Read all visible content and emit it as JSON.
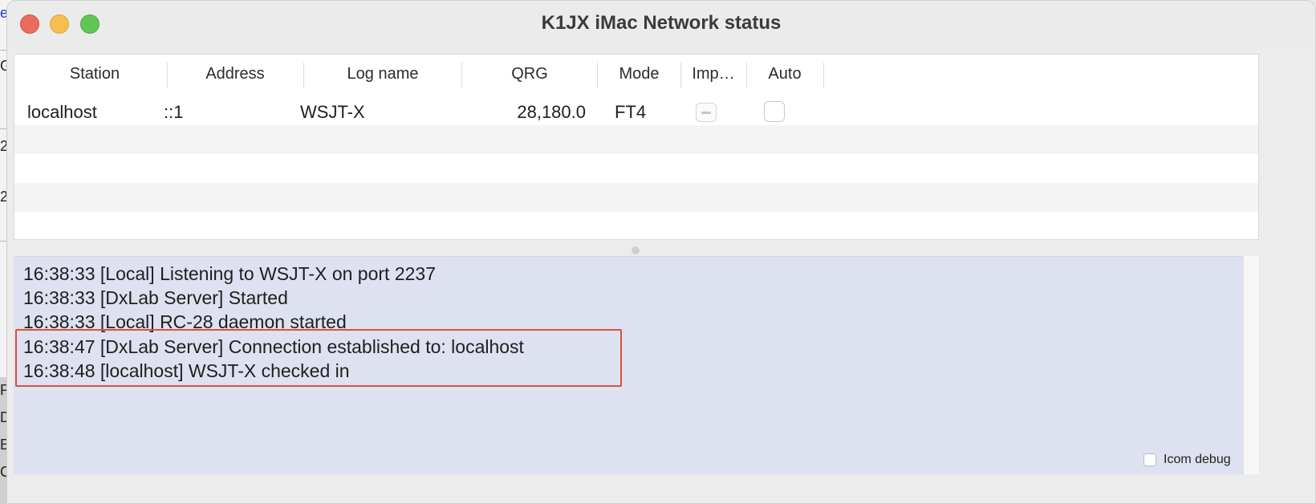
{
  "window": {
    "title": "K1JX iMac Network status"
  },
  "background_fragments": [
    "e",
    "G:",
    "2",
    "2",
    "P",
    "D",
    "E",
    "C"
  ],
  "table": {
    "columns": [
      "Station",
      "Address",
      "Log name",
      "QRG",
      "Mode",
      "Imp…",
      "Auto"
    ],
    "rows": [
      {
        "station": "localhost",
        "address": "::1",
        "log_name": "WSJT-X",
        "qrg": "28,180.0",
        "mode": "FT4",
        "imp": "mixed",
        "auto": false
      }
    ]
  },
  "log": {
    "lines": [
      "16:38:33 [Local] Listening to WSJT-X on port 2237",
      "16:38:33 [DxLab Server] Started",
      "16:38:33 [Local] RC-28 daemon started",
      "16:38:47 [DxLab Server] Connection established to: localhost",
      "16:38:48 [localhost] WSJT-X checked in"
    ],
    "highlighted_lines": [
      3,
      4
    ],
    "highlight_color": "#d9513e",
    "background_color": "#dde1f0"
  },
  "icom_debug": {
    "label": "Icom debug",
    "checked": false
  }
}
